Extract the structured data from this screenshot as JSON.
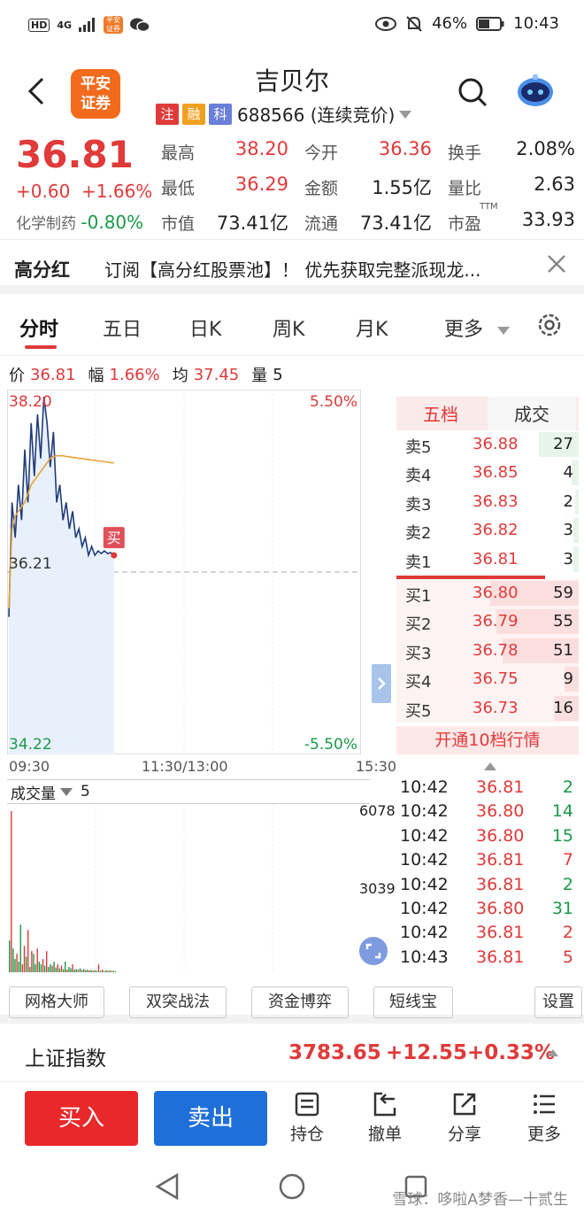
{
  "status": {
    "sig": "4G",
    "chip_hd": "HD",
    "app_chip": "平安证券",
    "battery": "46%",
    "time": "10:43"
  },
  "header": {
    "title": "吉贝尔",
    "logo_line1": "平安",
    "logo_line2": "证券",
    "tags": [
      "注",
      "融",
      "科"
    ],
    "code_label": "688566 (连续竞价)"
  },
  "quote": {
    "price": "36.81",
    "change": "+0.60",
    "change_pct": "+1.66%",
    "sector_name": "化学制药",
    "sector_pct": "-0.80%",
    "grid": [
      [
        {
          "k": "最高",
          "v": "38.20",
          "c": "red"
        },
        {
          "k": "今开",
          "v": "36.36",
          "c": "red"
        },
        {
          "k": "换手",
          "v": "2.08%",
          "c": "dark"
        }
      ],
      [
        {
          "k": "最低",
          "v": "36.29",
          "c": "red"
        },
        {
          "k": "金额",
          "v": "1.55亿",
          "c": "dark"
        },
        {
          "k": "量比",
          "v": "2.63",
          "c": "dark"
        }
      ],
      [
        {
          "k": "市值",
          "v": "73.41亿",
          "c": "dark"
        },
        {
          "k": "流通",
          "v": "73.41亿",
          "c": "dark"
        },
        {
          "k": "市盈",
          "v": "33.93",
          "c": "dark"
        }
      ]
    ],
    "ttm": "TTM"
  },
  "banner": {
    "title": "高分红",
    "message": "订阅【高分红股票池】！ 优先获取完整派现龙..."
  },
  "tabs": [
    "分时",
    "五日",
    "日K",
    "周K",
    "月K",
    "更多"
  ],
  "priceline": {
    "price_label": "价",
    "price": "36.81",
    "amp_label": "幅",
    "amp": "1.66%",
    "avg_label": "均",
    "avg": "37.45",
    "vol_label": "量",
    "vol": "5"
  },
  "chart_data": {
    "type": "line",
    "y_axis_left": {
      "top": "38.20",
      "mid": "36.21",
      "bottom": "34.22"
    },
    "y_axis_right": {
      "top": "5.50%",
      "bottom": "-5.50%"
    },
    "ylim": [
      34.22,
      38.2
    ],
    "prev_close": 36.21,
    "x_ticks": [
      "09:30",
      "11:30/13:00",
      "15:30"
    ],
    "series": [
      {
        "values": [
          35.7,
          37.0,
          36.6,
          37.2,
          36.8,
          37.6,
          37.0,
          37.9,
          37.3,
          38.0,
          37.5,
          38.2,
          37.9,
          37.4,
          37.8,
          37.0,
          37.2,
          36.8,
          37.0,
          36.7,
          36.9,
          36.6,
          36.7,
          36.5,
          36.6,
          36.4,
          36.5,
          36.4,
          36.45,
          36.42,
          36.45,
          36.42,
          36.43,
          36.4
        ]
      },
      {
        "values": [
          35.8,
          36.7,
          36.85,
          36.9,
          36.95,
          37.0,
          37.1,
          37.2,
          37.25,
          37.3,
          37.35,
          37.4,
          37.45,
          37.5,
          37.52,
          37.53,
          37.53,
          37.53,
          37.52,
          37.52,
          37.51,
          37.51,
          37.5,
          37.5,
          37.49,
          37.49,
          37.48,
          37.48,
          37.47,
          37.47,
          37.46,
          37.46,
          37.45,
          37.45
        ]
      }
    ],
    "buy_marker": "买",
    "volume": {
      "label": "成交量",
      "value": "5",
      "ticks": [
        "6078",
        "3039"
      ],
      "bars": [
        1200,
        6100,
        900,
        500,
        700,
        400,
        1800,
        300,
        1000,
        600,
        1600,
        200,
        800,
        700,
        300,
        900,
        400,
        300,
        500,
        250,
        800,
        200,
        300,
        250,
        400,
        180,
        300,
        150,
        250,
        120,
        400,
        100,
        200,
        150,
        300,
        100,
        120,
        100,
        150,
        90,
        120,
        80,
        100,
        70,
        90,
        60,
        80,
        60,
        300,
        50,
        100,
        40,
        80,
        60,
        70,
        50,
        60,
        40
      ],
      "colors": [
        "g",
        "r",
        "g",
        "g",
        "r",
        "g",
        "g",
        "r",
        "r",
        "g",
        "r",
        "g",
        "r",
        "g",
        "g",
        "r",
        "g",
        "g",
        "r",
        "g",
        "r",
        "g",
        "g",
        "r",
        "g",
        "g",
        "r",
        "g",
        "r",
        "g",
        "g",
        "r",
        "g",
        "g",
        "r",
        "g",
        "g",
        "r",
        "g",
        "g",
        "r",
        "g",
        "g",
        "r",
        "g",
        "r",
        "g",
        "g",
        "r",
        "g",
        "r",
        "g",
        "g",
        "r",
        "g",
        "r",
        "g",
        "g"
      ]
    }
  },
  "orderbook": {
    "tabs": [
      "五档",
      "成交"
    ],
    "asks": [
      {
        "label": "卖5",
        "price": "36.88",
        "qty": "27",
        "bar": 0.45
      },
      {
        "label": "卖4",
        "price": "36.85",
        "qty": "4",
        "bar": 0.08
      },
      {
        "label": "卖3",
        "price": "36.83",
        "qty": "2",
        "bar": 0.04
      },
      {
        "label": "卖2",
        "price": "36.82",
        "qty": "3",
        "bar": 0.06
      },
      {
        "label": "卖1",
        "price": "36.81",
        "qty": "3",
        "bar": 0.06
      }
    ],
    "bids": [
      {
        "label": "买1",
        "price": "36.80",
        "qty": "59",
        "bar": 1.0
      },
      {
        "label": "买2",
        "price": "36.79",
        "qty": "55",
        "bar": 0.93
      },
      {
        "label": "买3",
        "price": "36.78",
        "qty": "51",
        "bar": 0.86
      },
      {
        "label": "买4",
        "price": "36.75",
        "qty": "9",
        "bar": 0.16
      },
      {
        "label": "买5",
        "price": "36.73",
        "qty": "16",
        "bar": 0.28
      }
    ],
    "open10": "开通10档行情"
  },
  "trades": [
    {
      "t": "10:42",
      "p": "36.81",
      "n": "2",
      "c": "green"
    },
    {
      "t": "10:42",
      "p": "36.80",
      "n": "14",
      "c": "green"
    },
    {
      "t": "10:42",
      "p": "36.80",
      "n": "15",
      "c": "green"
    },
    {
      "t": "10:42",
      "p": "36.81",
      "n": "7",
      "c": "red"
    },
    {
      "t": "10:42",
      "p": "36.81",
      "n": "2",
      "c": "green"
    },
    {
      "t": "10:42",
      "p": "36.80",
      "n": "31",
      "c": "green"
    },
    {
      "t": "10:42",
      "p": "36.81",
      "n": "2",
      "c": "red"
    },
    {
      "t": "10:43",
      "p": "36.81",
      "n": "5",
      "c": "red"
    }
  ],
  "strategies": [
    "网格大师",
    "双突战法",
    "资金博弈",
    "短线宝",
    "设置"
  ],
  "index": {
    "name": "上证指数",
    "value": "3783.65",
    "change": "+12.55",
    "pct": "+0.33%"
  },
  "actions": {
    "buy": "买入",
    "sell": "卖出",
    "items": [
      "持仓",
      "撤单",
      "分享",
      "更多"
    ]
  },
  "watermark": "雪球：哆啦A梦香—十贰生",
  "colors": {
    "red": "#e03a3a",
    "green": "#1a9a48",
    "blue": "#1f6fd8",
    "orange": "#f26b1d",
    "avg_line": "#e8a23a",
    "price_line": "#1f3c7a"
  }
}
